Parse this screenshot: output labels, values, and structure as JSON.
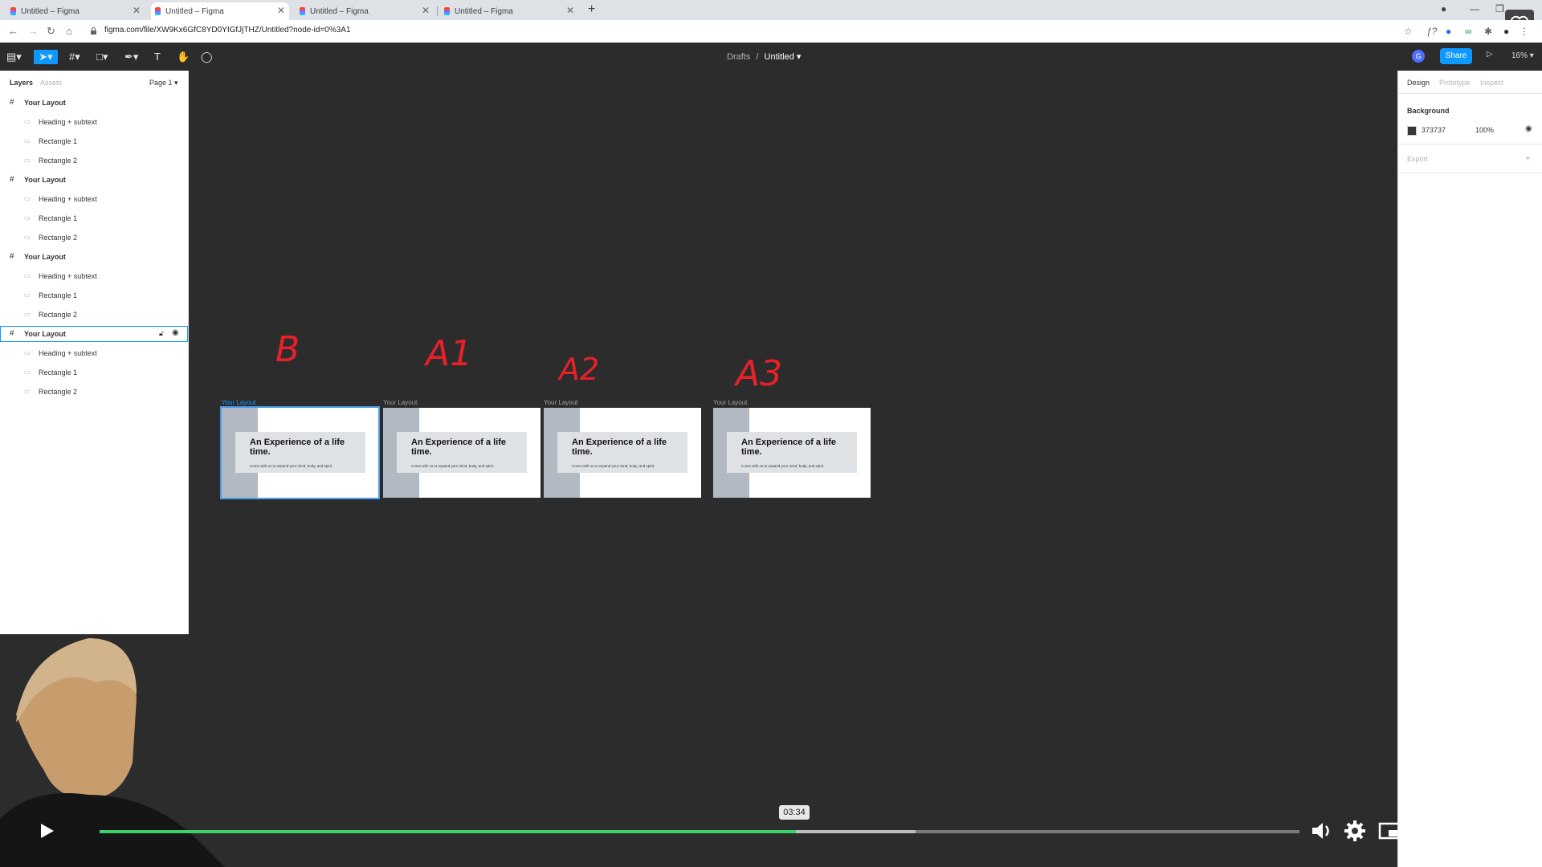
{
  "browser": {
    "tabs": [
      {
        "label": "Untitled – Figma",
        "active": false
      },
      {
        "label": "Untitled – Figma",
        "active": true
      },
      {
        "label": "Untitled – Figma",
        "active": false
      },
      {
        "label": "Untitled – Figma",
        "active": false
      }
    ],
    "url": "figma.com/file/XW9Kx6GfC8YD0YIGfJjTHZ/Untitled?node-id=0%3A1"
  },
  "figma": {
    "breadcrumb_root": "Drafts",
    "breadcrumb_sep": "/",
    "file_name": "Untitled",
    "avatar": "G",
    "share_label": "Share",
    "zoom": "16%",
    "left_tabs": {
      "layers": "Layers",
      "assets": "Assets",
      "page": "Page 1"
    },
    "layers": [
      {
        "name": "Your Layout",
        "kind": "frame"
      },
      {
        "name": "Heading + subtext",
        "kind": "child"
      },
      {
        "name": "Rectangle 1",
        "kind": "child"
      },
      {
        "name": "Rectangle 2",
        "kind": "child"
      },
      {
        "name": "Your Layout",
        "kind": "frame"
      },
      {
        "name": "Heading + subtext",
        "kind": "child"
      },
      {
        "name": "Rectangle 1",
        "kind": "child"
      },
      {
        "name": "Rectangle 2",
        "kind": "child"
      },
      {
        "name": "Your Layout",
        "kind": "frame"
      },
      {
        "name": "Heading + subtext",
        "kind": "child"
      },
      {
        "name": "Rectangle 1",
        "kind": "child"
      },
      {
        "name": "Rectangle 2",
        "kind": "child"
      },
      {
        "name": "Your Layout",
        "kind": "frame",
        "selected": true
      },
      {
        "name": "Heading + subtext",
        "kind": "child"
      },
      {
        "name": "Rectangle 1",
        "kind": "child"
      },
      {
        "name": "Rectangle 2",
        "kind": "child"
      }
    ],
    "right_tabs": {
      "design": "Design",
      "prototype": "Prototype",
      "inspect": "Inspect"
    },
    "background_label": "Background",
    "background_hex": "373737",
    "background_opacity": "100%",
    "export_label": "Export",
    "frames": [
      {
        "title": "Your Layout",
        "heading": "An Experience of a life time.",
        "subtext": "Come with us to expand your mind, body, and spirit.",
        "selected": true
      },
      {
        "title": "Your Layout",
        "heading": "An Experience of a life time.",
        "subtext": "Come with us to expand your mind, body, and spirit.",
        "selected": false
      },
      {
        "title": "Your Layout",
        "heading": "An Experience of a life time.",
        "subtext": "Come with us to expand your mind, body, and spirit.",
        "selected": false
      },
      {
        "title": "Your Layout",
        "heading": "An Experience of a life time.",
        "subtext": "Come with us to expand your mind, body, and spirit.",
        "selected": false
      }
    ],
    "annotations": [
      "B",
      "A1",
      "A2",
      "A3"
    ]
  },
  "video": {
    "time": "03:34",
    "progress": 0.58,
    "buffered": 0.68,
    "brand": "vimeo",
    "accent_color": "#3ed16b"
  }
}
